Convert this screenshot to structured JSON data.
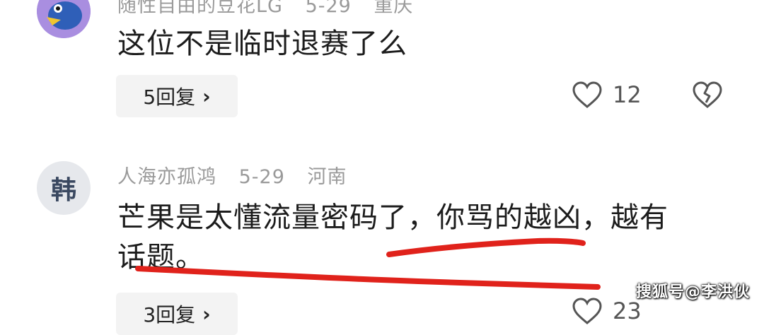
{
  "comments": [
    {
      "username": "随性自由的豆花LG",
      "date": "5-29",
      "location": "重庆",
      "text": "这位不是临时退赛了么",
      "replies_label": "5回复",
      "like_count": "12"
    },
    {
      "username": "人海亦孤鸿",
      "date": "5-29",
      "location": "河南",
      "avatar_char": "韩",
      "text_line1": "芒果是太懂流量密码了，你骂的越凶，越有",
      "text_line2": "话题。",
      "replies_label": "3回复",
      "like_count": "23"
    }
  ],
  "watermark": "搜狐号@李洪伙",
  "colors": {
    "annotation_red": "#e0221b",
    "meta_gray": "#9a9a9a",
    "pill_bg": "#f3f3f3"
  }
}
